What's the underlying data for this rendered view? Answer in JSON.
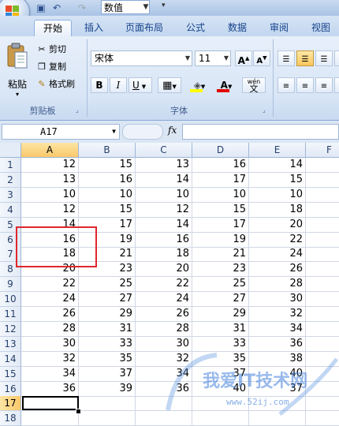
{
  "quick_access": {
    "name_field": "数值"
  },
  "tabs": [
    "开始",
    "插入",
    "页面布局",
    "公式",
    "数据",
    "审阅",
    "视图"
  ],
  "clipboard": {
    "paste": "粘贴",
    "cut": "剪切",
    "copy": "复制",
    "format_painter": "格式刷",
    "group": "剪贴板"
  },
  "font": {
    "name": "宋体",
    "size": "11",
    "bold": "B",
    "italic": "I",
    "underline": "U",
    "color_button": "A",
    "phonetic": "wén",
    "phonetic_char": "文",
    "group": "字体"
  },
  "formula_bar": {
    "cell_ref": "A17",
    "fx": "fx"
  },
  "columns": [
    "A",
    "B",
    "C",
    "D",
    "E",
    "F"
  ],
  "rows": [
    "1",
    "2",
    "3",
    "4",
    "5",
    "6",
    "7",
    "8",
    "9",
    "10",
    "11",
    "12",
    "13",
    "14",
    "15",
    "16",
    "17",
    "18"
  ],
  "cells": [
    [
      "12",
      "15",
      "13",
      "16",
      "14"
    ],
    [
      "13",
      "16",
      "14",
      "17",
      "15"
    ],
    [
      "10",
      "10",
      "10",
      "10",
      "10"
    ],
    [
      "12",
      "15",
      "12",
      "15",
      "18"
    ],
    [
      "14",
      "17",
      "14",
      "17",
      "20"
    ],
    [
      "16",
      "19",
      "16",
      "19",
      "22"
    ],
    [
      "18",
      "21",
      "18",
      "21",
      "24"
    ],
    [
      "20",
      "23",
      "20",
      "23",
      "26"
    ],
    [
      "22",
      "25",
      "22",
      "25",
      "28"
    ],
    [
      "24",
      "27",
      "24",
      "27",
      "30"
    ],
    [
      "26",
      "29",
      "26",
      "29",
      "32"
    ],
    [
      "28",
      "31",
      "28",
      "31",
      "34"
    ],
    [
      "30",
      "33",
      "30",
      "33",
      "36"
    ],
    [
      "32",
      "35",
      "32",
      "35",
      "38"
    ],
    [
      "34",
      "37",
      "34",
      "37",
      "40"
    ],
    [
      "36",
      "39",
      "36",
      "40",
      "37"
    ]
  ],
  "watermark": {
    "text": "我爱IT技术网",
    "url": "www.52ij.com"
  }
}
